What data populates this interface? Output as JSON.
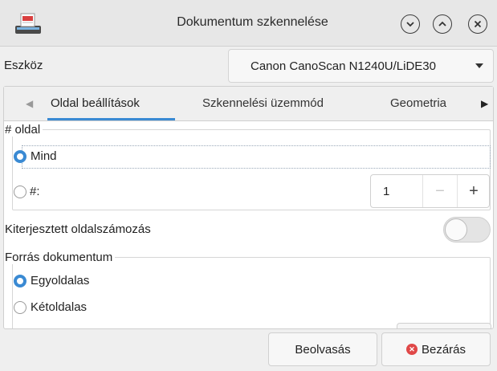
{
  "window": {
    "title": "Dokumentum szkennelése"
  },
  "device": {
    "label": "Eszköz",
    "selected": "Canon CanoScan N1240U/LiDE30"
  },
  "tabs": [
    {
      "label": "Oldal beállítások",
      "active": true
    },
    {
      "label": "Szkennelési üzemmód",
      "active": false
    },
    {
      "label": "Geometria",
      "active": false
    }
  ],
  "pages": {
    "frame_label": "# oldal",
    "option_all": "Mind",
    "option_count": "#:",
    "count_value": "1",
    "minus": "−",
    "plus": "+"
  },
  "extended_numbering": {
    "label": "Kiterjesztett oldalszámozás",
    "enabled": false
  },
  "source": {
    "frame_label": "Forrás dokumentum",
    "option_single": "Egyoldalas",
    "option_double": "Kétoldalas"
  },
  "buttons": {
    "scan": "Beolvasás",
    "close": "Bezárás"
  },
  "colors": {
    "accent": "#3a8ad3",
    "close_icon": "#e04848"
  }
}
